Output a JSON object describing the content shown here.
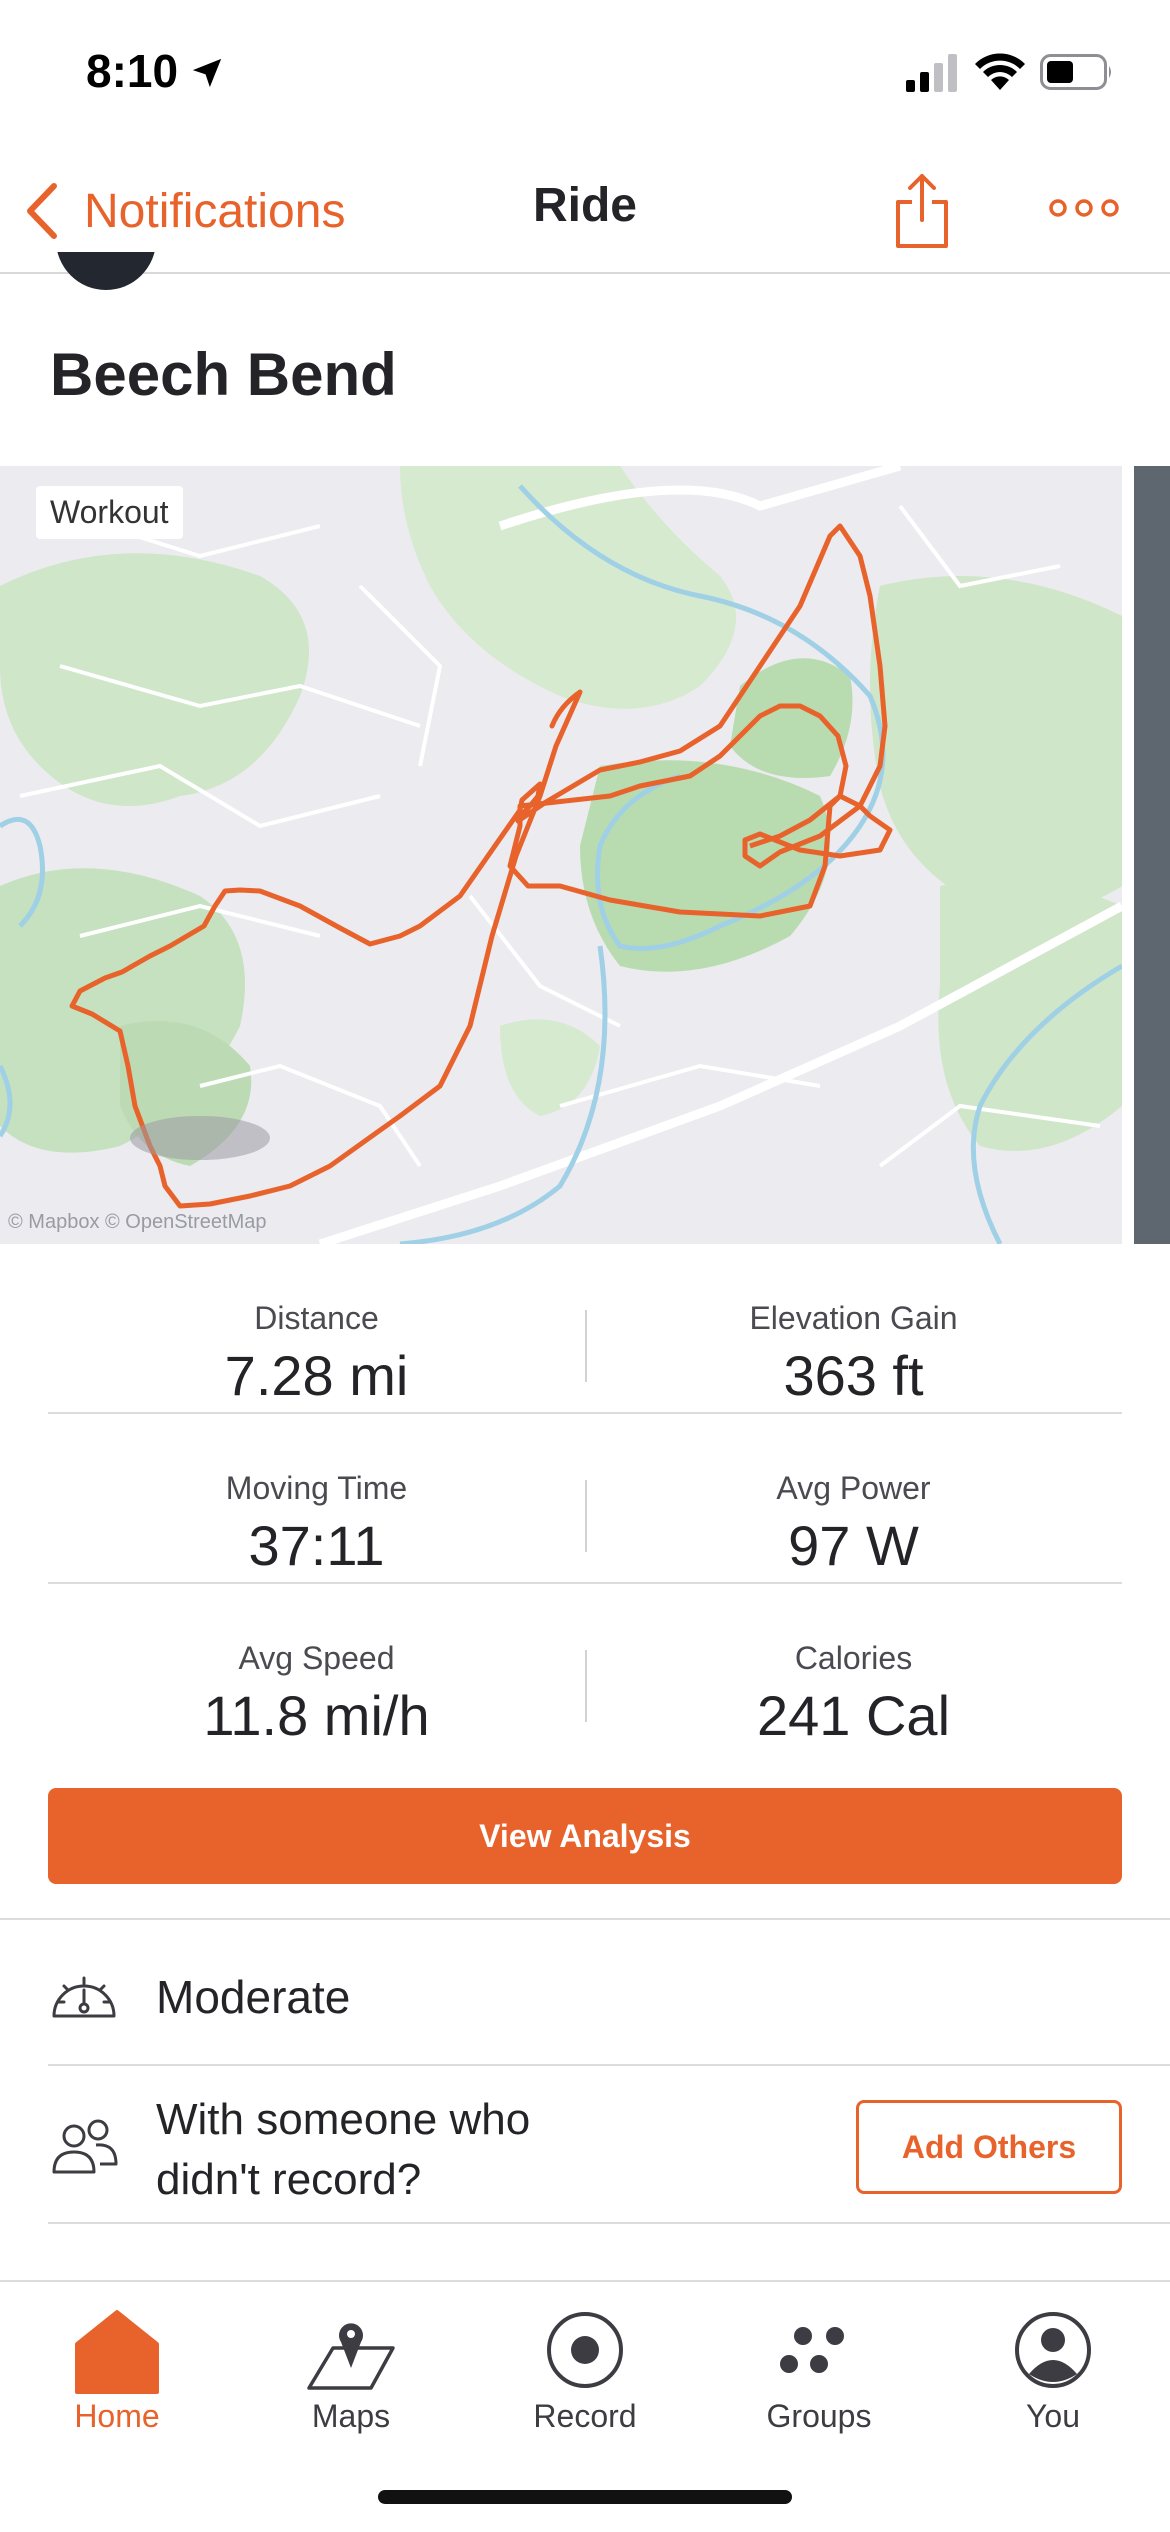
{
  "status_bar": {
    "time": "8:10",
    "icons": [
      "location-arrow-icon",
      "cellular-signal-icon",
      "wifi-icon",
      "battery-icon"
    ]
  },
  "nav": {
    "back_label": "Notifications",
    "title": "Ride",
    "actions": [
      "share-icon",
      "more-icon"
    ]
  },
  "activity": {
    "title": "Beech Bend"
  },
  "map": {
    "badge": "Workout",
    "attribution": "© Mapbox © OpenStreetMap",
    "route_color": "#e8632b"
  },
  "stats": [
    [
      {
        "label": "Distance",
        "value": "7.28 mi"
      },
      {
        "label": "Elevation Gain",
        "value": "363 ft"
      }
    ],
    [
      {
        "label": "Moving Time",
        "value": "37:11"
      },
      {
        "label": "Avg Power",
        "value": "97 W"
      }
    ],
    [
      {
        "label": "Avg Speed",
        "value": "11.8 mi/h"
      },
      {
        "label": "Calories",
        "value": "241 Cal"
      }
    ]
  ],
  "view_analysis_label": "View Analysis",
  "perceived_exertion": {
    "icon": "gauge-icon",
    "label": "Moderate"
  },
  "others": {
    "icon": "people-icon",
    "line1": "With someone who",
    "line2": "didn't record?",
    "button_label": "Add Others"
  },
  "tabs": [
    {
      "label": "Home",
      "icon": "home-icon",
      "active": true
    },
    {
      "label": "Maps",
      "icon": "map-pin-icon",
      "active": false
    },
    {
      "label": "Record",
      "icon": "record-icon",
      "active": false
    },
    {
      "label": "Groups",
      "icon": "groups-icon",
      "active": false
    },
    {
      "label": "You",
      "icon": "profile-icon",
      "active": false
    }
  ],
  "colors": {
    "accent": "#e8632b",
    "text": "#242428",
    "divider": "#dcdce0"
  }
}
